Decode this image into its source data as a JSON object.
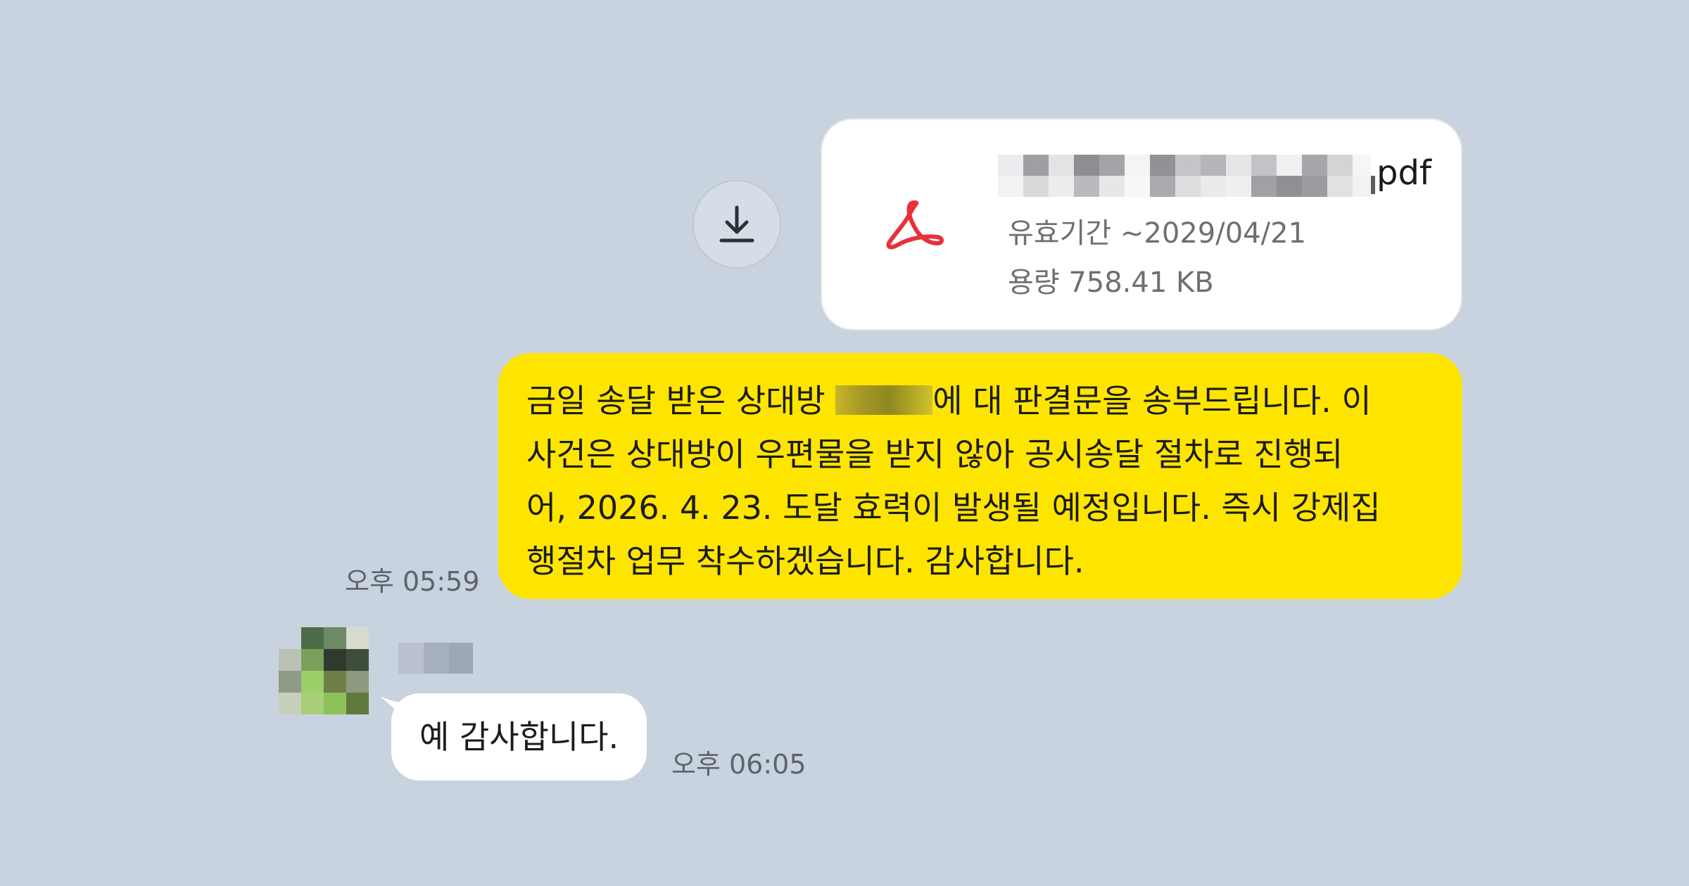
{
  "file_message": {
    "icon": "pdf-acrobat-icon",
    "file_name_visible_ext": "pdf",
    "expiry": "유효기간 ~2029/04/21",
    "size": "용량 758.41 KB",
    "download_icon": "download-icon",
    "accent_color": "#e8303a"
  },
  "outgoing_message": {
    "line1_before": "금일 송달 받은 상대방 ",
    "line1_after": "에 대 판결문을 송부드립니다. 이",
    "line2": "사건은 상대방이 우편물을 받지 않아 공시송달 절차로 진행되",
    "line3": "어, 2026. 4. 23. 도달 효력이 발생될 예정입니다. 즉시 강제집",
    "line4": "행절차 업무 착수하겠습니다. 감사합니다.",
    "time": "오후 05:59",
    "bubble_color": "#fee500"
  },
  "incoming_message": {
    "text": "예 감사합니다.",
    "time": "오후 06:05",
    "bubble_color": "#ffffff"
  },
  "background_color": "#c9d2df"
}
